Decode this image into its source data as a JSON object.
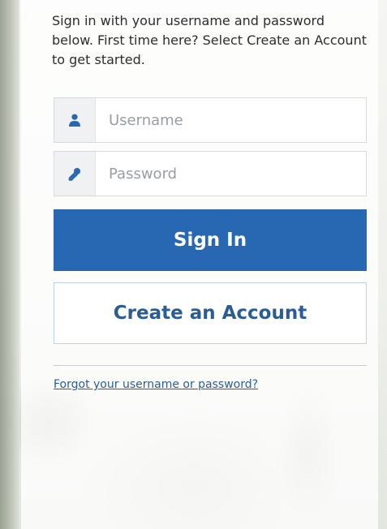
{
  "intro": {
    "text": "Sign in with your username and password below. First time here? Select Create an Account to get started."
  },
  "username": {
    "placeholder": "Username",
    "icon": "user-icon"
  },
  "password": {
    "placeholder": "Password",
    "icon": "key-icon"
  },
  "buttons": {
    "sign_in": "Sign In",
    "create_account": "Create an Account"
  },
  "links": {
    "forgot": "Forgot your username or password?"
  },
  "colors": {
    "primary": "#2867b2",
    "link": "#2a5d96",
    "icon": "#2867b2"
  }
}
